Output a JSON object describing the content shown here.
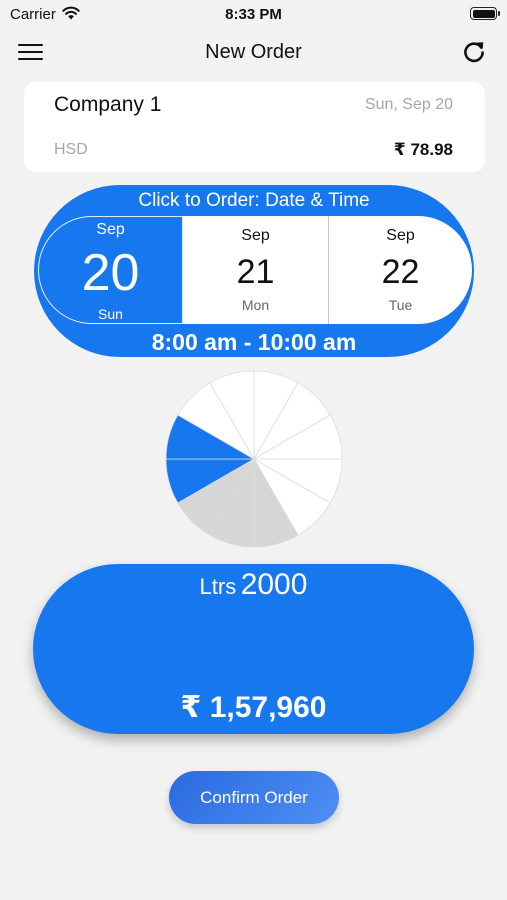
{
  "status_bar": {
    "carrier": "Carrier",
    "time": "8:33 PM"
  },
  "nav": {
    "title": "New Order",
    "menu_icon": "hamburger-menu-icon",
    "refresh_icon": "refresh-icon"
  },
  "company_card": {
    "company_name": "Company 1",
    "order_date": "Sun, Sep 20",
    "product": "HSD",
    "price": "₹ 78.98"
  },
  "date_panel": {
    "title": "Click to Order: Date & Time",
    "dates": [
      {
        "month": "Sep",
        "day": "20",
        "weekday": "Sun",
        "selected": true
      },
      {
        "month": "Sep",
        "day": "21",
        "weekday": "Mon",
        "selected": false
      },
      {
        "month": "Sep",
        "day": "22",
        "weekday": "Tue",
        "selected": false
      }
    ],
    "time_slot": "8:00 am - 10:00 am"
  },
  "time_wheel": {
    "segments_total": 12,
    "selected_segments": [
      8,
      9
    ],
    "disabled_segments": [
      5,
      6,
      7
    ],
    "colors": {
      "selected": "#1677ef",
      "disabled": "#d6d6d6",
      "available": "#ffffff"
    }
  },
  "quantity": {
    "unit": "Ltrs",
    "value": "2000",
    "total": "₹ 1,57,960"
  },
  "actions": {
    "confirm_label": "Confirm Order"
  },
  "colors": {
    "accent": "#1677ef",
    "background": "#f2f2f2",
    "muted_text": "#a6a6a6"
  }
}
